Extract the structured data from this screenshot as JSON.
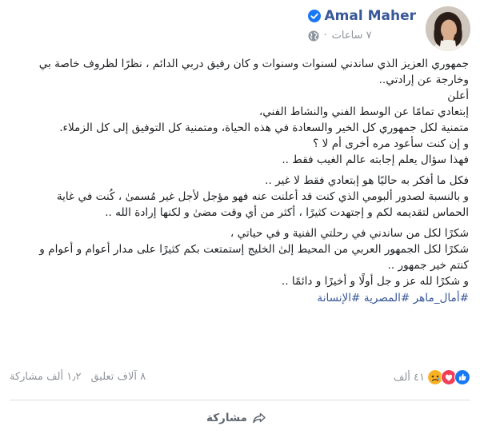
{
  "author": {
    "name": "Amal Maher",
    "verified": true
  },
  "meta": {
    "time": "٧ ساعات",
    "separator": "·",
    "privacy_icon": "globe-icon"
  },
  "post": {
    "lines": [
      "جمهوري العزيز الذي ساندني لسنوات وسنوات و كان رفيق دربي الدائم ، نظرًا لظروف خاصة بي",
      "وخارجة عن إرادتي..",
      "أعلن",
      "إبتعادي تمامًا عن الوسط الفني والنشاط الفني،",
      "متمنية لكل جمهوري كل الخير والسعادة في هذه الحياة، ومتمنية كل التوفيق إلى كل الزملاء.",
      "و إن كنت سأعود مره أخرى أم لا ؟",
      "فهذا سؤال يعلم إجابته عالم الغيب فقط ..",
      "فكل ما أفكر به حاليًا هو إبتعادي فقط لا غير ..",
      "و بالنسبة لصدور ألبومي الذي كنت قد أعلنت عنه فهو مؤجل لأجل غير مُسمىٰ ، كُنت في غاية",
      "الحماس لتقديمه لكم و إجتهدت كثيرًا ، أكثر من أي وقت مضىٰ و لكنها إرادة الله ..",
      "شكرًا لكل من ساندني في رحلتي الفنية و في حياتي ،",
      "شكرًا لكل الجمهور العربي من المحيط إلىٰ الخليج إستمتعت بكم كثيرًا على مدار أعوام و أعوام و",
      "كنتم خير جمهور ..",
      "و شكرًا لله عز و جل أولًا و أخيرًا و دائمًا .."
    ],
    "hashtags": [
      "#أمال_ماهر",
      "#المصرية",
      "#الإنسانة"
    ]
  },
  "reactions": {
    "count": "٤١ ألف",
    "types": [
      "sad",
      "love",
      "like"
    ]
  },
  "stats": {
    "comments": "٨ آلاف تعليق",
    "shares": "١٫٢ ألف مشاركة"
  },
  "actions": {
    "share_label": "مشاركة"
  },
  "colors": {
    "link": "#385898",
    "secondary_text": "#90949c",
    "like_blue": "#1877f2",
    "love_red": "#f33e58",
    "sad_yellow": "#f7b125"
  }
}
